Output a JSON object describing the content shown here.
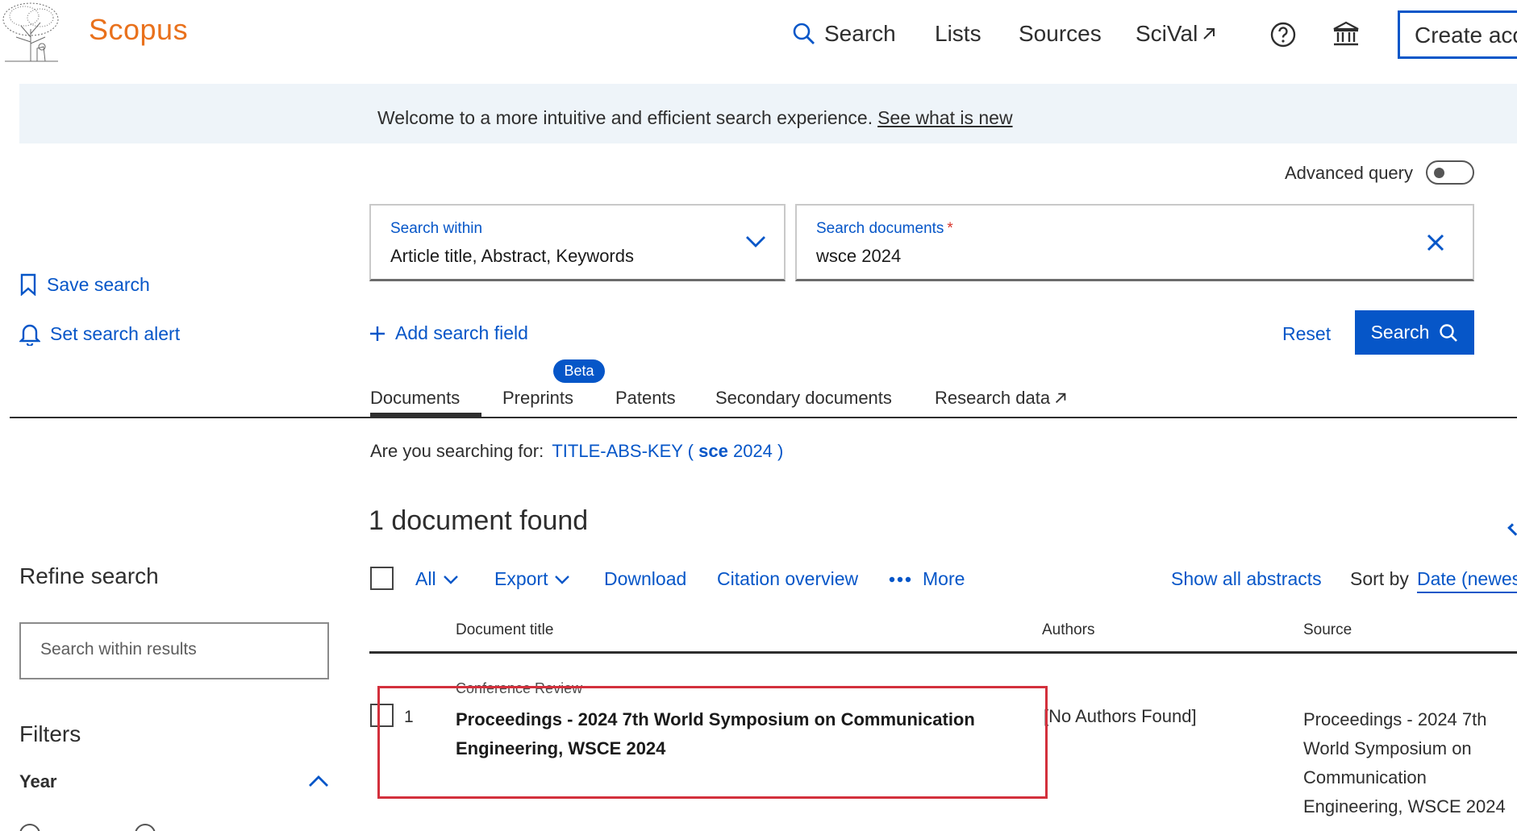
{
  "header": {
    "brand": "Scopus",
    "nav": {
      "search": "Search",
      "lists": "Lists",
      "sources": "Sources",
      "scival": "SciVal"
    },
    "create_account": "Create acc"
  },
  "banner": {
    "text": "Welcome to a more intuitive and efficient search experience.",
    "link": "See what is new"
  },
  "advanced_query": "Advanced query",
  "search_within": {
    "label": "Search within",
    "value": "Article title, Abstract, Keywords"
  },
  "search_documents": {
    "label": "Search documents",
    "required": "*",
    "value": "wsce 2024"
  },
  "sidebar": {
    "save_search": "Save search",
    "set_alert": "Set search alert",
    "refine": "Refine search",
    "search_within_results": "Search within results",
    "filters": "Filters",
    "year": "Year"
  },
  "actions": {
    "add_field": "Add search field",
    "reset": "Reset",
    "search": "Search"
  },
  "tabs": {
    "documents": "Documents",
    "preprints": "Preprints",
    "beta": "Beta",
    "patents": "Patents",
    "secondary": "Secondary documents",
    "research_data": "Research data"
  },
  "suggestion": {
    "prefix": "Are you searching for:",
    "query_start": "TITLE-ABS-KEY (",
    "query_bold": "sce",
    "query_end": "2024 )"
  },
  "results": {
    "count": "1 document found",
    "toolbar": {
      "all": "All",
      "export": "Export",
      "download": "Download",
      "citation": "Citation overview",
      "more": "More",
      "show_abstracts": "Show all abstracts",
      "sort_by": "Sort by",
      "sort_value": "Date (newest)"
    },
    "columns": {
      "title": "Document title",
      "authors": "Authors",
      "source": "Source"
    },
    "rows": [
      {
        "num": "1",
        "type": "Conference Review",
        "title": "Proceedings - 2024 7th World Symposium on Communication Engineering, WSCE 2024",
        "authors": "[No Authors Found]",
        "source": "Proceedings - 2024 7th World Symposium on Communication Engineering, WSCE 2024"
      }
    ]
  },
  "colors": {
    "brand": "#e9711c",
    "link": "#0656c8",
    "highlight": "#d3303c"
  }
}
